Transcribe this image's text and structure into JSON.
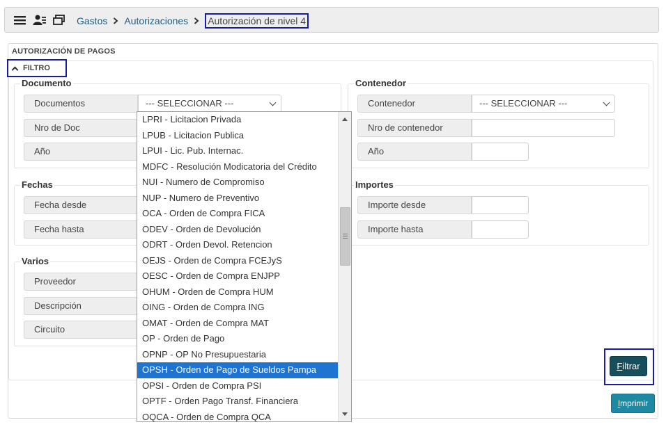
{
  "breadcrumb": {
    "items": [
      "Gastos",
      "Autorizaciones"
    ],
    "current": "Autorización de nivel 4"
  },
  "icons": [
    "hamburger-menu-icon",
    "users-icon",
    "windows-icon",
    "chevron-right-icon",
    "chevron-up-icon",
    "chevron-down-icon"
  ],
  "panel": {
    "title": "AUTORIZACIÓN DE PAGOS"
  },
  "filtro": {
    "label": "FILTRO"
  },
  "documento": {
    "legend": "Documento",
    "documentos_label": "Documentos",
    "documentos_value": "--- SELECCIONAR ---",
    "nro_doc_label": "Nro de Doc",
    "anio_label": "Año"
  },
  "contenedor": {
    "legend": "Contenedor",
    "contenedor_label": "Contenedor",
    "contenedor_value": "--- SELECCIONAR ---",
    "nro_contenedor_label": "Nro de contenedor",
    "anio_label": "Año"
  },
  "fechas": {
    "legend": "Fechas",
    "desde_label": "Fecha desde",
    "hasta_label": "Fecha hasta"
  },
  "importes": {
    "legend": "Importes",
    "desde_label": "Importe desde",
    "hasta_label": "Importe hasta"
  },
  "varios": {
    "legend": "Varios",
    "proveedor_label": "Proveedor",
    "descripcion_label": "Descripción",
    "circuito_label": "Circuito"
  },
  "dropdown": {
    "selected_index": 16,
    "options": [
      "LPRI - Licitacion Privada",
      "LPUB - Licitacion Publica",
      "LPUI - Lic. Pub. Internac.",
      "MDFC - Resolución Modicatoria del Crédito",
      "NUI - Numero de Compromiso",
      "NUP - Numero de Preventivo",
      "OCA - Orden de Compra FICA",
      "ODEV - Orden de Devolución",
      "ODRT - Orden Devol. Retencion",
      "OEJS - Orden de Compra FCEJyS",
      "OESC - Orden de Compra ENJPP",
      "OHUM - Orden de Compra HUM",
      "OING - Orden de Compra ING",
      "OMAT - Orden de Compra MAT",
      "OP - Orden de Pago",
      "OPNP - OP No Presupuestaria",
      "OPSH - Orden de Pago de Sueldos Pampa",
      "OPSI - Orden de Compra PSI",
      "OPTF - Orden Pago Transf. Financiera",
      "OQCA - Orden de Compra QCA"
    ]
  },
  "buttons": {
    "filtrar_first": "F",
    "filtrar_rest": "iltrar",
    "imprimir_first": "I",
    "imprimir_rest": "mprimir"
  }
}
